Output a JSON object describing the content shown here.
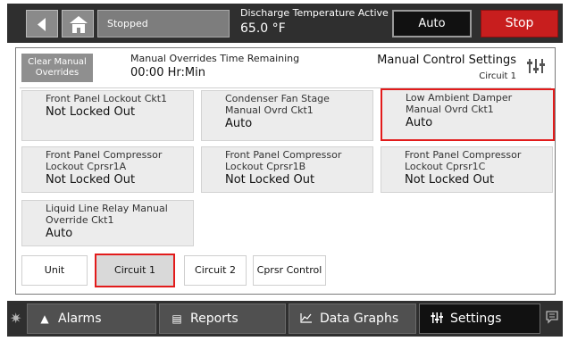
{
  "topbar": {
    "status": "Stopped",
    "message_label": "Discharge Temperature Active",
    "message_value": "65.0 °F",
    "auto_label": "Auto",
    "stop_label": "Stop",
    "back_icon": "back-arrow-icon",
    "home_icon": "home-icon"
  },
  "panel": {
    "clear_button": "Clear Manual Overrides",
    "timer_label": "Manual Overrides Time Remaining",
    "timer_value": "00:00 Hr:Min",
    "title": "Manual Control Settings",
    "subtitle": "Circuit 1",
    "settings_icon": "settings-sliders-icon"
  },
  "cards": [
    {
      "label": "Front Panel Lockout Ckt1",
      "value": "Not Locked Out"
    },
    {
      "label": "Condenser Fan Stage Manual Ovrd Ckt1",
      "value": "Auto"
    },
    {
      "label": "Low Ambient Damper Manual Ovrd Ckt1",
      "value": "Auto"
    },
    {
      "label": "Front Panel Compressor Lockout Cprsr1A",
      "value": "Not Locked Out"
    },
    {
      "label": "Front Panel Compressor Lockout Cprsr1B",
      "value": "Not Locked Out"
    },
    {
      "label": "Front Panel Compressor Lockout Cprsr1C",
      "value": "Not Locked Out"
    },
    {
      "label": "Liquid Line Relay Manual Override Ckt1",
      "value": "Auto"
    }
  ],
  "tabs": [
    {
      "label": "Unit"
    },
    {
      "label": "Circuit 1"
    },
    {
      "label": "Circuit 2"
    },
    {
      "label": "Cprsr Control"
    }
  ],
  "nav": [
    {
      "label": "Alarms",
      "icon": "bell-icon"
    },
    {
      "label": "Reports",
      "icon": "document-icon"
    },
    {
      "label": "Data Graphs",
      "icon": "line-chart-icon"
    },
    {
      "label": "Settings",
      "icon": "settings-sliders-icon"
    }
  ],
  "colors": {
    "bar_bg": "#2f2f2f",
    "stop": "#c81e1e",
    "highlight": "#e21b1b",
    "card_bg": "#ececec"
  }
}
